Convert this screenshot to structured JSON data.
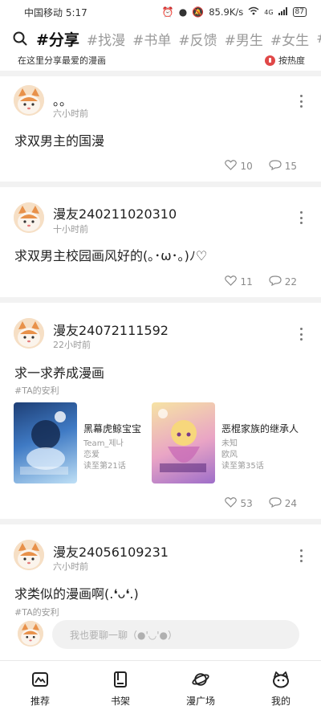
{
  "status_bar": {
    "carrier": "中国移动",
    "time": "5:17",
    "network_speed": "85.9K/s",
    "signal": "4G",
    "battery": "87"
  },
  "tabs": {
    "items": [
      {
        "label": "#分享",
        "active": true
      },
      {
        "label": "#找漫",
        "active": false
      },
      {
        "label": "#书单",
        "active": false
      },
      {
        "label": "#反馈",
        "active": false
      },
      {
        "label": "#男生",
        "active": false
      },
      {
        "label": "#女生",
        "active": false
      },
      {
        "label": "#",
        "active": false
      }
    ]
  },
  "subbar": {
    "subtitle": "在这里分享最爱的漫画",
    "sort_label": "按热度"
  },
  "posts": [
    {
      "username": "。。",
      "time": "六小时前",
      "content": "求双男主的国漫",
      "likes": "10",
      "comments": "15"
    },
    {
      "username": "漫友240211020310",
      "time": "十小时前",
      "content": "求双男主校园画风好的(｡･ω･｡)ﾉ♡",
      "likes": "11",
      "comments": "22"
    },
    {
      "username": "漫友24072111592",
      "time": "22小时前",
      "content": "求一求养成漫画",
      "tag": "#TA的安利",
      "manga": [
        {
          "title": "黑幕虎鲸宝宝",
          "author": "Team_제나",
          "genre": "恋爱",
          "progress": "读至第21话"
        },
        {
          "title": "恶棍家族的继承人",
          "author": "未知",
          "genre": "欧风",
          "progress": "读至第35话"
        }
      ],
      "likes": "53",
      "comments": "24"
    },
    {
      "username": "漫友24056109231",
      "time": "六小时前",
      "content": "求类似的漫画啊(.❛ᴗ❛.)",
      "tag": "#TA的安利"
    }
  ],
  "comment_box": {
    "placeholder": "我也要聊一聊（●'◡'●）"
  },
  "bottom_nav": {
    "items": [
      {
        "label": "推荐",
        "icon": "recommend-icon"
      },
      {
        "label": "书架",
        "icon": "bookshelf-icon"
      },
      {
        "label": "漫广场",
        "icon": "planet-icon"
      },
      {
        "label": "我的",
        "icon": "profile-icon"
      }
    ]
  },
  "colors": {
    "accent_red": "#e04848",
    "divider": "#f2f2f2",
    "muted_text": "#9a9a9a"
  }
}
